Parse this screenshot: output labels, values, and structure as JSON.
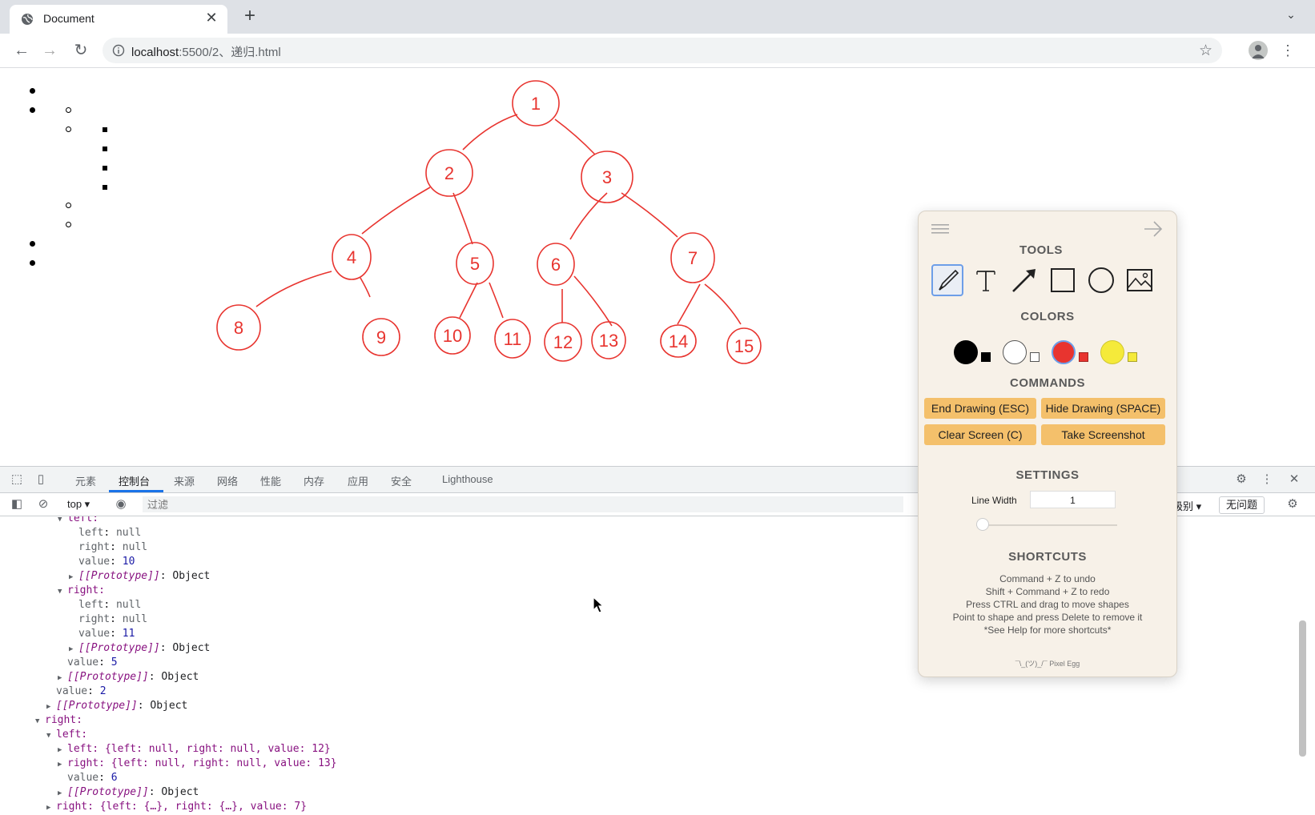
{
  "browser": {
    "tab_title": "Document",
    "tab_close": "✕",
    "new_tab": "+",
    "url_host": "localhost",
    "url_path": ":5500/2、递归.html",
    "icons": [
      "globe-icon",
      "back-arrow-icon",
      "forward-arrow-icon",
      "reload-icon",
      "info-icon",
      "star-icon",
      "profile-icon",
      "menu-dots-icon"
    ]
  },
  "tree": {
    "nodes": [
      "1",
      "2",
      "3",
      "4",
      "5",
      "6",
      "7",
      "8",
      "9",
      "10",
      "11",
      "12",
      "13",
      "14",
      "15"
    ],
    "stroke_color": "#e8342f"
  },
  "devtools": {
    "tabs": [
      "元素",
      "控制台",
      "来源",
      "网络",
      "性能",
      "内存",
      "应用",
      "安全",
      "Lighthouse"
    ],
    "active_tab": "控制台",
    "context": "top ▾",
    "filter_placeholder": "过滤",
    "levels": "级别 ▾",
    "issues": "无问题",
    "console_lines": [
      {
        "indent": 1,
        "toggle": "▼",
        "text": "left:"
      },
      {
        "indent": 2,
        "key": "left",
        "value": "null"
      },
      {
        "indent": 2,
        "key": "right",
        "value": "null"
      },
      {
        "indent": 2,
        "key": "value",
        "value": "10"
      },
      {
        "indent": 2,
        "toggle": "▶",
        "proto": "[[Prototype]]",
        "value": "Object"
      },
      {
        "indent": 1,
        "toggle": "▼",
        "text": "right:"
      },
      {
        "indent": 2,
        "key": "left",
        "value": "null"
      },
      {
        "indent": 2,
        "key": "right",
        "value": "null"
      },
      {
        "indent": 2,
        "key": "value",
        "value": "11"
      },
      {
        "indent": 2,
        "toggle": "▶",
        "proto": "[[Prototype]]",
        "value": "Object"
      },
      {
        "indent": 1,
        "key": "value",
        "value": "5"
      },
      {
        "indent": 1,
        "toggle": "▶",
        "proto": "[[Prototype]]",
        "value": "Object"
      },
      {
        "indent": 0,
        "key": "value",
        "value": "2"
      },
      {
        "indent": 0,
        "toggle": "▶",
        "proto": "[[Prototype]]",
        "value": "Object"
      },
      {
        "indent": -1,
        "toggle": "▼",
        "text": "right:"
      },
      {
        "indent": 0,
        "toggle": "▼",
        "text": "left:"
      },
      {
        "indent": 1,
        "toggle": "▶",
        "text": "left: {left: null, right: null, value: 12}"
      },
      {
        "indent": 1,
        "toggle": "▶",
        "text": "right: {left: null, right: null, value: 13}"
      },
      {
        "indent": 1,
        "key": "value",
        "value": "6"
      },
      {
        "indent": 1,
        "toggle": "▶",
        "proto": "[[Prototype]]",
        "value": "Object"
      },
      {
        "indent": 0,
        "toggle": "▶",
        "text": "right: {left: {…}, right: {…}, value: 7}"
      }
    ]
  },
  "pixel_egg": {
    "tools_title": "TOOLS",
    "tools": [
      "pen-icon",
      "text-icon",
      "arrow-icon",
      "rectangle-icon",
      "circle-icon",
      "image-icon"
    ],
    "colors_title": "COLORS",
    "colors": [
      "#000000",
      "#ffffff",
      "#e8342f",
      "#f5ea3a"
    ],
    "commands_title": "COMMANDS",
    "commands": [
      "End Drawing (ESC)",
      "Hide Drawing (SPACE)",
      "Clear Screen (C)",
      "Take Screenshot"
    ],
    "settings_title": "SETTINGS",
    "line_width_label": "Line Width",
    "line_width_value": "1",
    "shortcuts_title": "SHORTCUTS",
    "shortcuts": [
      "Command + Z to undo",
      "Shift + Command + Z to redo",
      "Press CTRL and drag to move shapes",
      "Point to shape and press Delete to remove it",
      "*See Help for more shortcuts*"
    ],
    "footer": "¯\\_(ツ)_/¯ Pixel Egg"
  }
}
